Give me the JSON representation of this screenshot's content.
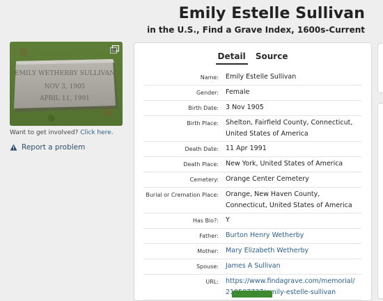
{
  "header": {
    "title": "Emily Estelle Sullivan",
    "subtitle": "in the U.S., Find a Grave Index, 1600s-Current"
  },
  "photo": {
    "inscription": [
      "EMILY WETHERBY SULLIVAN",
      "NOV 3, 1905",
      "APRIL 11, 1991"
    ],
    "expand_icon": "expand-image-icon"
  },
  "involve": {
    "prefix": "Want to get involved?",
    "link": "Click here."
  },
  "report": {
    "label": "Report a problem",
    "icon": "warning-icon"
  },
  "tabs": [
    {
      "label": "Detail",
      "active": true
    },
    {
      "label": "Source",
      "active": false
    }
  ],
  "details": [
    {
      "label": "Name:",
      "value": "Emily Estelle Sullivan"
    },
    {
      "label": "Gender:",
      "value": "Female"
    },
    {
      "label": "Birth Date:",
      "value": "3 Nov 1905"
    },
    {
      "label": "Birth Place:",
      "value": "Shelton, Fairfield County, Connecticut, United States of America"
    },
    {
      "label": "Death Date:",
      "value": "11 Apr 1991"
    },
    {
      "label": "Death Place:",
      "value": "New York, United States of America"
    },
    {
      "label": "Cemetery:",
      "value": "Orange Center Cemetery"
    },
    {
      "label": "Burial or Cremation Place:",
      "value": "Orange, New Haven County, Connecticut, United States of America"
    },
    {
      "label": "Has Bio?:",
      "value": "Y"
    },
    {
      "label": "Father:",
      "value": "Burton Henry Wetherby",
      "link": true
    },
    {
      "label": "Mother:",
      "value": "Mary Elizabeth Wetherby",
      "link": true
    },
    {
      "label": "Spouse:",
      "value": "James A Sullivan",
      "link": true
    },
    {
      "label": "URL:",
      "value": "https://www.findagrave.com/memorial/219507737/emily-estelle-sullivan",
      "link": true
    }
  ],
  "colors": {
    "link": "#2c5f8a",
    "button_green": "#3e8a2e"
  }
}
